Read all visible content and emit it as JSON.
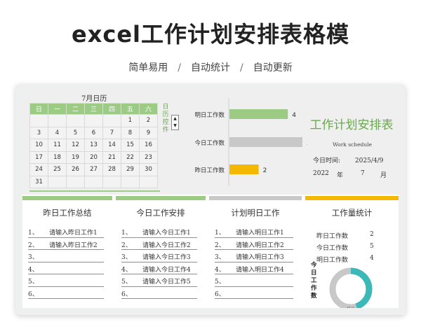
{
  "header": {
    "title": "excel工作计划安排表格模",
    "subtitle": [
      "简单易用",
      "自动统计",
      "自动更新"
    ],
    "separator": "/"
  },
  "calendar": {
    "title": "7月日历",
    "weekdays": [
      "日",
      "一",
      "二",
      "三",
      "四",
      "五",
      "六"
    ],
    "rows": [
      [
        "",
        "",
        "",
        "",
        "",
        "1",
        "2"
      ],
      [
        "3",
        "4",
        "5",
        "6",
        "7",
        "8",
        "9"
      ],
      [
        "10",
        "11",
        "12",
        "13",
        "14",
        "15",
        "16"
      ],
      [
        "17",
        "18",
        "19",
        "20",
        "21",
        "22",
        "23"
      ],
      [
        "24",
        "25",
        "26",
        "27",
        "28",
        "29",
        "30"
      ],
      [
        "31",
        "",
        "",
        "",
        "",
        "",
        ""
      ]
    ],
    "control_label": "日历控件",
    "spin_up": "▲",
    "spin_down": "▼"
  },
  "chart_data": {
    "type": "bar",
    "orientation": "horizontal",
    "categories": [
      "明日工作数",
      "今日工作数",
      "昨日工作数"
    ],
    "values": [
      4,
      5,
      2
    ],
    "colors": [
      "#9ccc84",
      "#c8c8c8",
      "#f5b800"
    ],
    "xlim": [
      0,
      5
    ]
  },
  "work": {
    "title": "工作计划安排表",
    "subtitle": "Work schedule",
    "today_label": "今日时间:",
    "today_value": "2025/4/9",
    "year": "2022",
    "year_unit": "年",
    "month": "7",
    "month_unit": "月"
  },
  "cards": [
    {
      "title": "昨日工作总结",
      "color": "#9ccc84",
      "items": [
        {
          "num": "1、",
          "text": "请输入昨日工作1"
        },
        {
          "num": "2、",
          "text": "请输入昨日工作2"
        },
        {
          "num": "3、",
          "text": ""
        },
        {
          "num": "4、",
          "text": ""
        },
        {
          "num": "5、",
          "text": ""
        },
        {
          "num": "6、",
          "text": ""
        }
      ]
    },
    {
      "title": "今日工作安排",
      "color": "#9ccc84",
      "items": [
        {
          "num": "1、",
          "text": "请输入今日工作1"
        },
        {
          "num": "2、",
          "text": "请输入今日工作2"
        },
        {
          "num": "3、",
          "text": "请输入今日工作3"
        },
        {
          "num": "4、",
          "text": "请输入今日工作4"
        },
        {
          "num": "5、",
          "text": "请输入今日工作5"
        },
        {
          "num": "6、",
          "text": ""
        }
      ]
    },
    {
      "title": "计划明日工作",
      "color": "#c8c8c8",
      "items": [
        {
          "num": "1、",
          "text": "请输入明日工作1"
        },
        {
          "num": "2、",
          "text": "请输入明日工作2"
        },
        {
          "num": "3、",
          "text": "请输入明日工作3"
        },
        {
          "num": "4、",
          "text": "请输入明日工作4"
        },
        {
          "num": "5、",
          "text": ""
        },
        {
          "num": "6、",
          "text": ""
        }
      ]
    }
  ],
  "stats": {
    "title": "工作量统计",
    "color": "#f5b800",
    "rows": [
      {
        "label": "昨日工作数",
        "value": "2"
      },
      {
        "label": "今日工作数",
        "value": "5"
      },
      {
        "label": "明日工作数",
        "value": "4"
      }
    ],
    "donut_label": "今日工作数",
    "donut_percent": "45%",
    "donut_fraction": 0.45,
    "donut_color": "#3bb8b8",
    "donut_track": "#c8c8c8"
  }
}
